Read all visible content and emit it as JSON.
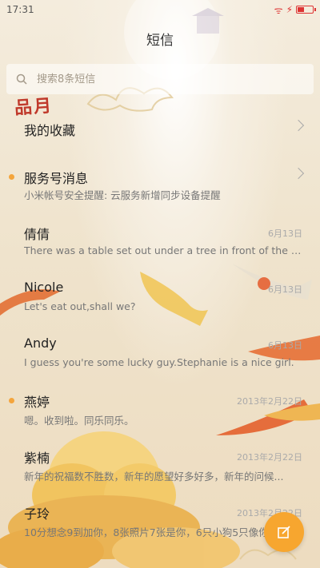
{
  "status_bar": {
    "time": "17:31"
  },
  "header": {
    "title": "短信"
  },
  "search": {
    "placeholder": "搜索8条短信"
  },
  "brand": {
    "logo_text": "品月"
  },
  "items": [
    {
      "name": "我的收藏",
      "date": "",
      "message": "",
      "unread": false,
      "chevron": true
    },
    {
      "name": "服务号消息",
      "date": "",
      "message": "小米帐号安全提醒: 云服务新增同步设备提醒",
      "unread": true,
      "chevron": true
    },
    {
      "name": "倩倩",
      "date": "6月13日",
      "message": "There was a table set out under a tree in front of the ho...",
      "unread": false,
      "chevron": false
    },
    {
      "name": "Nicole",
      "date": "6月13日",
      "message": "Let's eat out,shall we?",
      "unread": false,
      "chevron": false
    },
    {
      "name": "Andy",
      "date": "6月13日",
      "message": "I guess you're some lucky guy.Stephanie is a nice girl.",
      "unread": false,
      "chevron": false
    },
    {
      "name": "燕婷",
      "date": "2013年2月22日",
      "message": "嗯。收到啦。同乐同乐。",
      "unread": true,
      "chevron": false
    },
    {
      "name": "紫楠",
      "date": "2013年2月22日",
      "message": "新年的祝福数不胜数，新年的愿望好多好多，新年的问候...",
      "unread": false,
      "chevron": false
    },
    {
      "name": "子玲",
      "date": "2013年2月22日",
      "message": "10分想念9到加你，8张照片7张是你，6只小狗5只像你",
      "unread": false,
      "chevron": false
    }
  ],
  "colors": {
    "accent": "#f7a62f",
    "unread_dot": "#f4a53c",
    "logo": "#c0392b"
  },
  "icons": {
    "search": "search-icon",
    "compose": "compose-icon"
  }
}
